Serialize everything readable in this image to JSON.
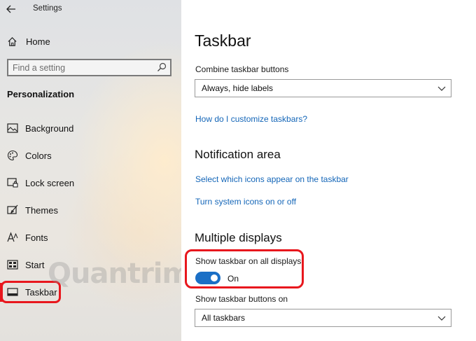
{
  "window": {
    "title": "Settings"
  },
  "sidebar": {
    "home_label": "Home",
    "search_placeholder": "Find a setting",
    "section_header": "Personalization",
    "items": [
      {
        "label": "Background",
        "icon": "background-image-icon"
      },
      {
        "label": "Colors",
        "icon": "palette-icon"
      },
      {
        "label": "Lock screen",
        "icon": "lock-screen-icon"
      },
      {
        "label": "Themes",
        "icon": "themes-brush-icon"
      },
      {
        "label": "Fonts",
        "icon": "fonts-icon"
      },
      {
        "label": "Start",
        "icon": "start-menu-icon"
      },
      {
        "label": "Taskbar",
        "icon": "taskbar-icon",
        "selected": true
      }
    ],
    "watermark": "Quantrimang"
  },
  "main": {
    "title": "Taskbar",
    "combine_label": "Combine taskbar buttons",
    "combine_value": "Always, hide labels",
    "customize_link": "How do I customize taskbars?",
    "notification_title": "Notification area",
    "notification_link_icons": "Select which icons appear on the taskbar",
    "notification_link_system": "Turn system icons on or off",
    "multiple_title": "Multiple displays",
    "show_all_label": "Show taskbar on all displays",
    "show_all_state": "On",
    "show_buttons_label": "Show taskbar buttons on",
    "show_buttons_value": "All taskbars"
  },
  "colors": {
    "accent": "#1a6fc6",
    "link": "#1466b8",
    "annotation_red": "#e8171d"
  }
}
